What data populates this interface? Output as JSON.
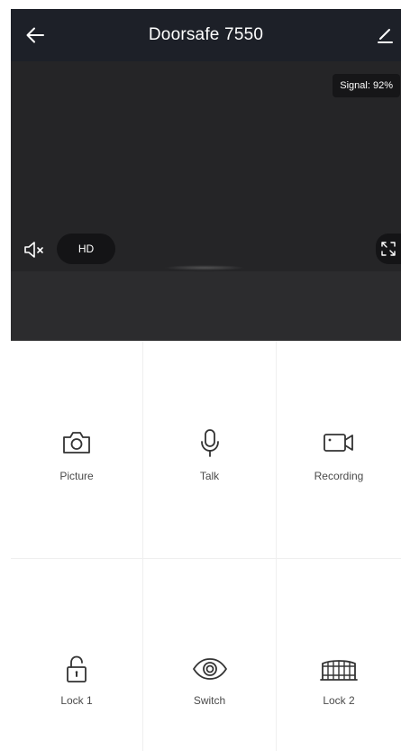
{
  "header": {
    "title": "Doorsafe 7550",
    "back_icon": "arrow-left-icon",
    "edit_icon": "pencil-icon"
  },
  "video": {
    "signal_label": "Signal: 92%",
    "quality_label": "HD",
    "mute_icon": "speaker-muted-icon",
    "fullscreen_icon": "expand-icon"
  },
  "controls": [
    {
      "label": "Picture",
      "icon": "camera-icon"
    },
    {
      "label": "Talk",
      "icon": "microphone-icon"
    },
    {
      "label": "Recording",
      "icon": "video-camera-icon"
    },
    {
      "label": "Lock 1",
      "icon": "padlock-icon"
    },
    {
      "label": "Switch",
      "icon": "eye-icon"
    },
    {
      "label": "Lock 2",
      "icon": "gate-icon"
    }
  ],
  "colors": {
    "header_bg": "#1d2028",
    "video_bg": "#252527",
    "label_text": "#4a4a4a",
    "icon_stroke": "#333333"
  }
}
